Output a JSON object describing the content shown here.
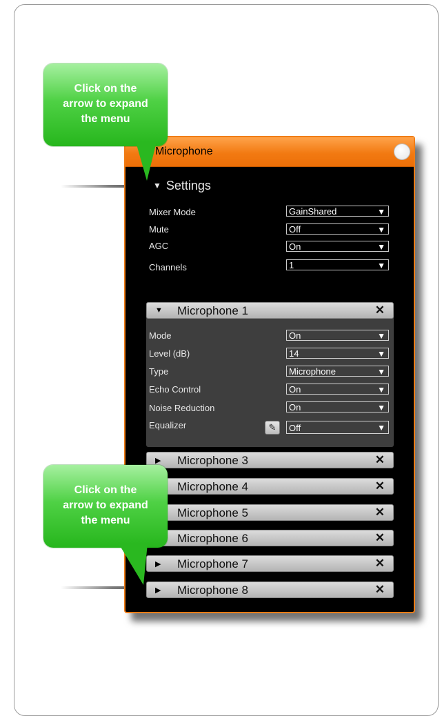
{
  "callouts": [
    {
      "line1": "Click on the",
      "line2": "arrow to expand",
      "line3": "the menu"
    },
    {
      "line1": "Click on the",
      "line2": "arrow to expand",
      "line3": "the menu"
    }
  ],
  "window": {
    "title": "Microphone",
    "settings_label": "Settings",
    "settings": [
      {
        "label": "Mixer Mode",
        "value": "GainShared"
      },
      {
        "label": "Mute",
        "value": "Off"
      },
      {
        "label": "AGC",
        "value": "On"
      },
      {
        "label": "Channels",
        "value": "1"
      }
    ],
    "expanded": {
      "name": "Microphone 1",
      "fields": [
        {
          "label": "Mode",
          "value": "On"
        },
        {
          "label": "Level (dB)",
          "value": "14"
        },
        {
          "label": "Type",
          "value": "Microphone"
        },
        {
          "label": "Echo Control",
          "value": "On"
        },
        {
          "label": "Noise Reduction",
          "value": "On"
        },
        {
          "label": "Equalizer",
          "value": "Off"
        }
      ]
    },
    "collapsed": [
      "Microphone 3",
      "Microphone 4",
      "Microphone 5",
      "Microphone 6",
      "Microphone 7",
      "Microphone 8"
    ],
    "close_glyph": "✕"
  },
  "icons": {
    "expand": "triangle-right-icon",
    "collapse": "triangle-down-icon",
    "close": "close-icon",
    "edit": "pencil-icon",
    "dropdown": "chevron-down-icon"
  },
  "colors": {
    "accent": "#f07d17",
    "callout": "#3cc532"
  }
}
